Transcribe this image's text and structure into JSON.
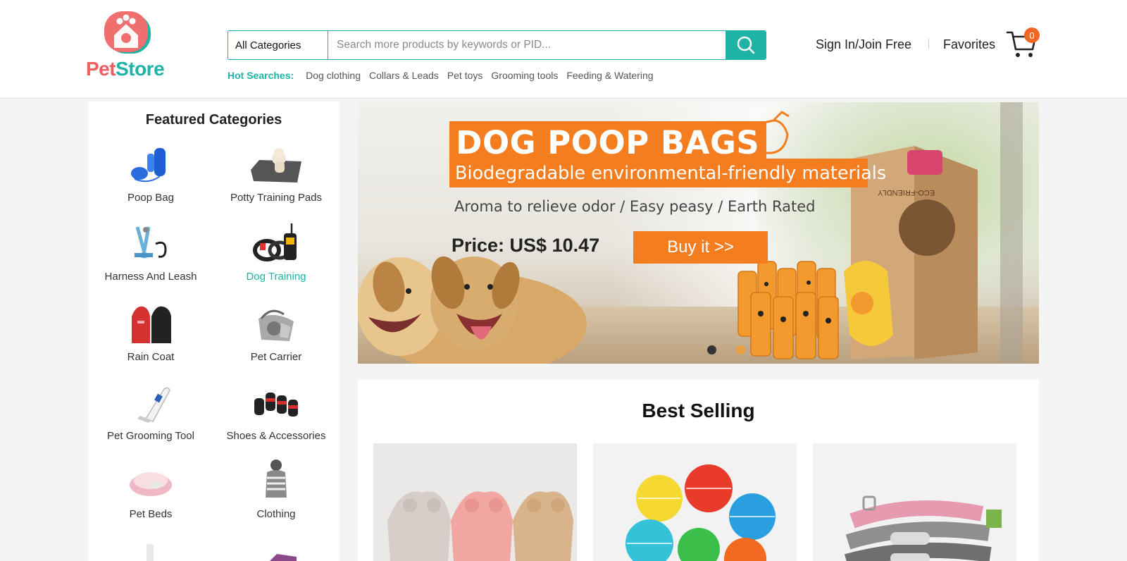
{
  "brand": {
    "name_part1": "Pet",
    "name_part2": "Store"
  },
  "search": {
    "category": "All Categories",
    "placeholder": "Search more products by keywords or PID...",
    "value": ""
  },
  "hot_searches": {
    "label": "Hot Searches:",
    "items": [
      "Dog clothing",
      "Collars & Leads",
      "Pet toys",
      "Grooming tools",
      "Feeding & Watering"
    ]
  },
  "account": {
    "signin": "Sign In/Join Free",
    "favorites": "Favorites",
    "cart_count": "0"
  },
  "sidebar": {
    "title": "Featured Categories",
    "items": [
      {
        "label": "Poop Bag",
        "icon": "poop-bag-icon"
      },
      {
        "label": "Potty Training Pads",
        "icon": "potty-pad-icon"
      },
      {
        "label": "Harness And Leash",
        "icon": "harness-icon"
      },
      {
        "label": "Dog Training",
        "icon": "training-collar-icon",
        "active": true
      },
      {
        "label": "Rain Coat",
        "icon": "raincoat-icon"
      },
      {
        "label": "Pet Carrier",
        "icon": "carrier-icon"
      },
      {
        "label": "Pet Grooming Tool",
        "icon": "clipper-icon"
      },
      {
        "label": "Shoes & Accessories",
        "icon": "shoes-icon"
      },
      {
        "label": "Pet Beds",
        "icon": "bed-icon"
      },
      {
        "label": "Clothing",
        "icon": "clothing-icon"
      }
    ]
  },
  "banner": {
    "title": "DOG POOP BAGS",
    "subtitle": "Biodegradable environmental-friendly materials",
    "tagline": "Aroma to relieve odor / Easy peasy / Earth Rated",
    "price": "Price: US$ 10.47",
    "cta": "Buy it >>",
    "box_text": "ECO-FRIENDLY",
    "slides": 2,
    "active_slide": 1,
    "colors": {
      "accent": "#f47d1f",
      "dot_active": "#333333",
      "dot_inactive": "#e8a040"
    }
  },
  "best_selling": {
    "title": "Best Selling",
    "products": [
      {
        "name": "Fleece pet coats",
        "image": "dog-fleece-coats"
      },
      {
        "name": "Rubber treat balls",
        "image": "treat-balls"
      },
      {
        "name": "Leather dog collars",
        "image": "dog-collars"
      }
    ]
  },
  "colors": {
    "brand_teal": "#1fb3a6",
    "brand_coral": "#ef5d5d",
    "badge": "#f26522"
  }
}
